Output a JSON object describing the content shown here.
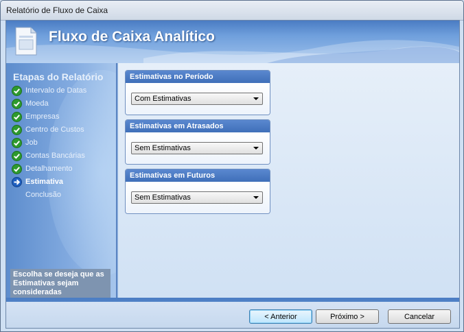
{
  "window": {
    "title": "Relatório de Fluxo de Caixa"
  },
  "banner": {
    "title": "Fluxo de Caixa Analítico",
    "icon": "document-icon"
  },
  "sidebar": {
    "heading": "Etapas do Relatório",
    "steps": [
      {
        "label": "Intervalo de Datas",
        "status": "done",
        "icon": "check-icon"
      },
      {
        "label": "Moeda",
        "status": "done",
        "icon": "check-icon"
      },
      {
        "label": "Empresas",
        "status": "done",
        "icon": "check-icon"
      },
      {
        "label": "Centro de Custos",
        "status": "done",
        "icon": "check-icon"
      },
      {
        "label": "Job",
        "status": "done",
        "icon": "check-icon"
      },
      {
        "label": "Contas Bancárias",
        "status": "done",
        "icon": "check-icon"
      },
      {
        "label": "Detalhamento",
        "status": "done",
        "icon": "check-icon"
      },
      {
        "label": "Estimativa",
        "status": "current",
        "icon": "arrow-right-icon"
      },
      {
        "label": "Conclusão",
        "status": "pending",
        "icon": ""
      }
    ],
    "hint": "Escolha se deseja que as Estimativas sejam consideradas"
  },
  "groups": [
    {
      "title": "Estimativas no Período",
      "value": "Com Estimativas"
    },
    {
      "title": "Estimativas em Atrasados",
      "value": "Sem Estimativas"
    },
    {
      "title": "Estimativas em Futuros",
      "value": "Sem Estimativas"
    }
  ],
  "footer": {
    "back_label": "< Anterior",
    "next_label": "Próximo >",
    "cancel_label": "Cancelar"
  },
  "colors": {
    "accent": "#3f6fb9",
    "check": "#2e9a2e",
    "current": "#1f5fbf"
  }
}
